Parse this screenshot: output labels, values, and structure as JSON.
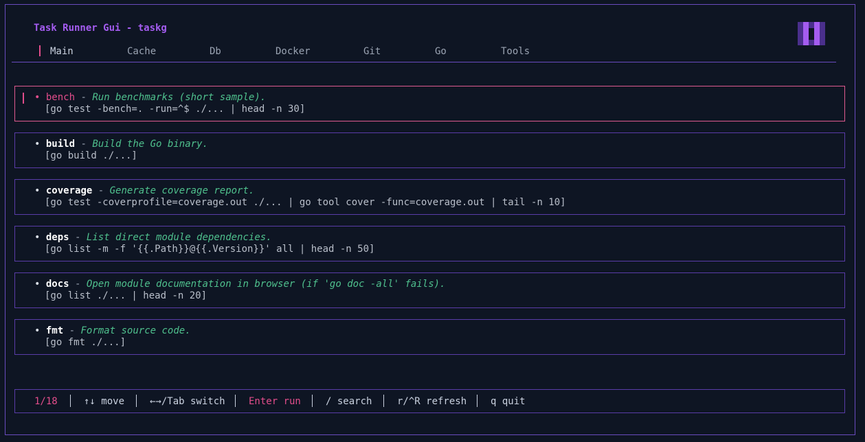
{
  "app": {
    "title": "Task Runner Gui - taskg",
    "colors": {
      "accent_purple": "#a45cf0",
      "accent_pink": "#e24d8b",
      "description_green": "#4fc08d",
      "border": "#6a4bbf",
      "background": "#0e1523"
    }
  },
  "logo": {
    "icon": "pixel-logo-icon"
  },
  "tabs": [
    {
      "label": "Main",
      "active": true
    },
    {
      "label": "Cache"
    },
    {
      "label": "Db"
    },
    {
      "label": "Docker"
    },
    {
      "label": "Git"
    },
    {
      "label": "Go"
    },
    {
      "label": "Tools"
    }
  ],
  "tasks": [
    {
      "bullet": "•",
      "name": "bench",
      "sep": "-",
      "description": "Run benchmarks (short sample).",
      "command": "[go test -bench=. -run=^$ ./... | head -n 30]",
      "selected": true
    },
    {
      "bullet": "•",
      "name": "build",
      "sep": "-",
      "description": "Build the Go binary.",
      "command": "[go build ./...]"
    },
    {
      "bullet": "•",
      "name": "coverage",
      "sep": "-",
      "description": "Generate coverage report.",
      "command": "[go test -coverprofile=coverage.out ./... | go tool cover -func=coverage.out | tail -n 10]"
    },
    {
      "bullet": "•",
      "name": "deps",
      "sep": "-",
      "description": "List direct module dependencies.",
      "command": "[go list -m -f '{{.Path}}@{{.Version}}' all | head -n 50]"
    },
    {
      "bullet": "•",
      "name": "docs",
      "sep": "-",
      "description": "Open module documentation in browser (if 'go doc -all' fails).",
      "command": "[go list ./... | head -n 20]"
    },
    {
      "bullet": "•",
      "name": "fmt",
      "sep": "-",
      "description": "Format source code.",
      "command": "[go fmt ./...]"
    }
  ],
  "statusbar": {
    "position": "1/18",
    "move": "↑↓ move",
    "switch": "←→/Tab switch",
    "run": "Enter run",
    "search": "/ search",
    "refresh": "r/^R refresh",
    "quit": "q quit"
  }
}
